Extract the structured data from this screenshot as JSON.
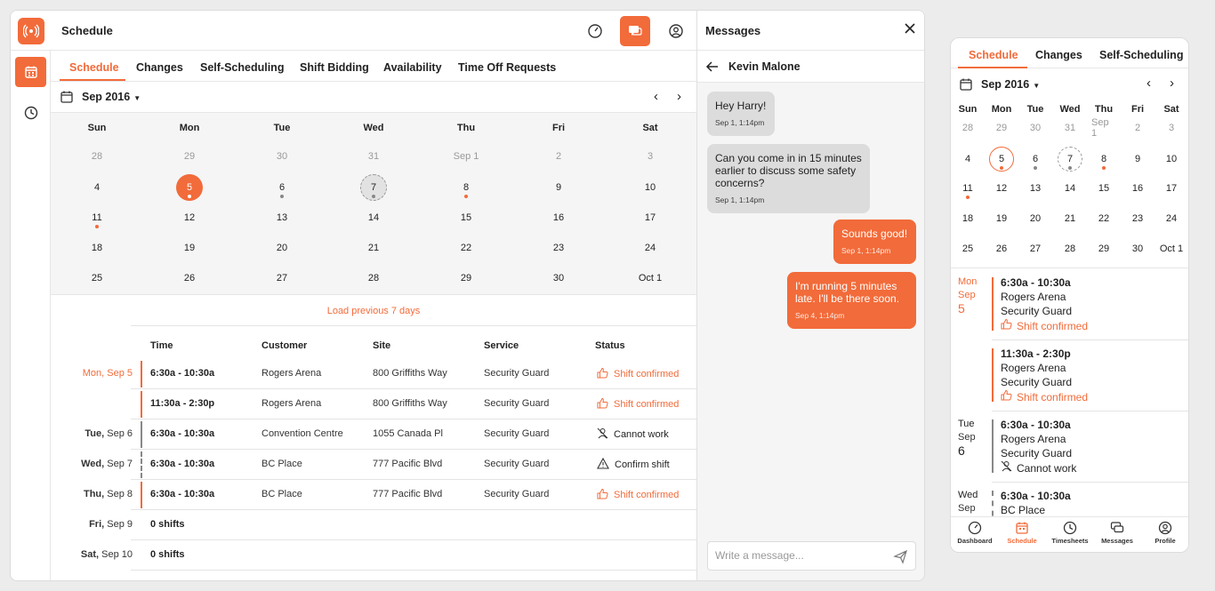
{
  "app": {
    "title": "Schedule"
  },
  "colors": {
    "accent": "#f26b3a",
    "muted": "#999999",
    "panel": "#f5f5f5"
  },
  "tabs": [
    "Schedule",
    "Changes",
    "Self-Scheduling",
    "Shift Bidding",
    "Availability",
    "Time Off Requests"
  ],
  "calendar": {
    "month_label": "Sep 2016",
    "weekdays": [
      "Sun",
      "Mon",
      "Tue",
      "Wed",
      "Thu",
      "Fri",
      "Sat"
    ],
    "weeks": [
      [
        "28",
        "29",
        "30",
        "31",
        "Sep 1",
        "2",
        "3"
      ],
      [
        "4",
        "5",
        "6",
        "7",
        "8",
        "9",
        "10"
      ],
      [
        "11",
        "12",
        "13",
        "14",
        "15",
        "16",
        "17"
      ],
      [
        "18",
        "19",
        "20",
        "21",
        "22",
        "23",
        "24"
      ],
      [
        "25",
        "26",
        "27",
        "28",
        "29",
        "30",
        "Oct 1"
      ]
    ]
  },
  "list": {
    "load_previous": "Load previous 7 days",
    "columns": [
      "Time",
      "Customer",
      "Site",
      "Service",
      "Status"
    ],
    "rows": [
      {
        "day": "Mon,",
        "date": "Sep 5",
        "time": "6:30a - 10:30a",
        "customer": "Rogers Arena",
        "site": "800 Griffiths Way",
        "service": "Security Guard",
        "status": "Shift confirmed"
      },
      {
        "day": "",
        "date": "",
        "time": "11:30a - 2:30p",
        "customer": "Rogers Arena",
        "site": "800 Griffiths Way",
        "service": "Security Guard",
        "status": "Shift confirmed"
      },
      {
        "day": "Tue,",
        "date": "Sep 6",
        "time": "6:30a - 10:30a",
        "customer": "Convention Centre",
        "site": "1055 Canada Pl",
        "service": "Security Guard",
        "status": "Cannot work"
      },
      {
        "day": "Wed,",
        "date": "Sep 7",
        "time": "6:30a - 10:30a",
        "customer": "BC Place",
        "site": "777 Pacific Blvd",
        "service": "Security Guard",
        "status": "Confirm shift"
      },
      {
        "day": "Thu,",
        "date": "Sep 8",
        "time": "6:30a - 10:30a",
        "customer": "BC Place",
        "site": "777 Pacific Blvd",
        "service": "Security Guard",
        "status": "Shift confirmed"
      },
      {
        "day": "Fri,",
        "date": "Sep 9",
        "time": "0 shifts"
      },
      {
        "day": "Sat,",
        "date": "Sep 10",
        "time": "0 shifts"
      }
    ]
  },
  "messages": {
    "title": "Messages",
    "contact": "Kevin Malone",
    "items": [
      {
        "text": "Hey Harry!",
        "time": "Sep 1, 1:14pm",
        "dir": "in"
      },
      {
        "text": "Can you come in in 15 minutes earlier to discuss some safety concerns?",
        "time": "Sep 1, 1:14pm",
        "dir": "in"
      },
      {
        "text": "Sounds good!",
        "time": "Sep 1, 1:14pm",
        "dir": "out"
      },
      {
        "text": "I'm running 5 minutes late. I'll be there soon.",
        "time": "Sep 4, 1:14pm",
        "dir": "out"
      }
    ],
    "input_placeholder": "Write a message..."
  },
  "mobile": {
    "tabs": [
      "Schedule",
      "Changes",
      "Self-Scheduling"
    ],
    "month_label": "Sep 2016",
    "weekdays": [
      "Sun",
      "Mon",
      "Tue",
      "Wed",
      "Thu",
      "Fri",
      "Sat"
    ],
    "weeks": [
      [
        "28",
        "29",
        "30",
        "31",
        "Sep 1",
        "2",
        "3"
      ],
      [
        "4",
        "5",
        "6",
        "7",
        "8",
        "9",
        "10"
      ],
      [
        "11",
        "12",
        "13",
        "14",
        "15",
        "16",
        "17"
      ],
      [
        "18",
        "19",
        "20",
        "21",
        "22",
        "23",
        "24"
      ],
      [
        "25",
        "26",
        "27",
        "28",
        "29",
        "30",
        "Oct 1"
      ]
    ],
    "days": [
      {
        "dow": "Mon",
        "month": "Sep",
        "num": "5",
        "shifts": [
          {
            "time": "6:30a - 10:30a",
            "customer": "Rogers Arena",
            "service": "Security Guard",
            "status": "Shift confirmed"
          },
          {
            "time": "11:30a - 2:30p",
            "customer": "Rogers Arena",
            "service": "Security Guard",
            "status": "Shift confirmed"
          }
        ]
      },
      {
        "dow": "Tue",
        "month": "Sep",
        "num": "6",
        "shifts": [
          {
            "time": "6:30a - 10:30a",
            "customer": "Rogers Arena",
            "service": "Security Guard",
            "status": "Cannot work"
          }
        ]
      },
      {
        "dow": "Wed",
        "month": "Sep",
        "num": "",
        "shifts": [
          {
            "time": "6:30a - 10:30a",
            "customer": "BC Place",
            "service": "",
            "status": ""
          }
        ]
      }
    ],
    "nav": [
      "Dashboard",
      "Schedule",
      "Timesheets",
      "Messages",
      "Profile"
    ]
  }
}
